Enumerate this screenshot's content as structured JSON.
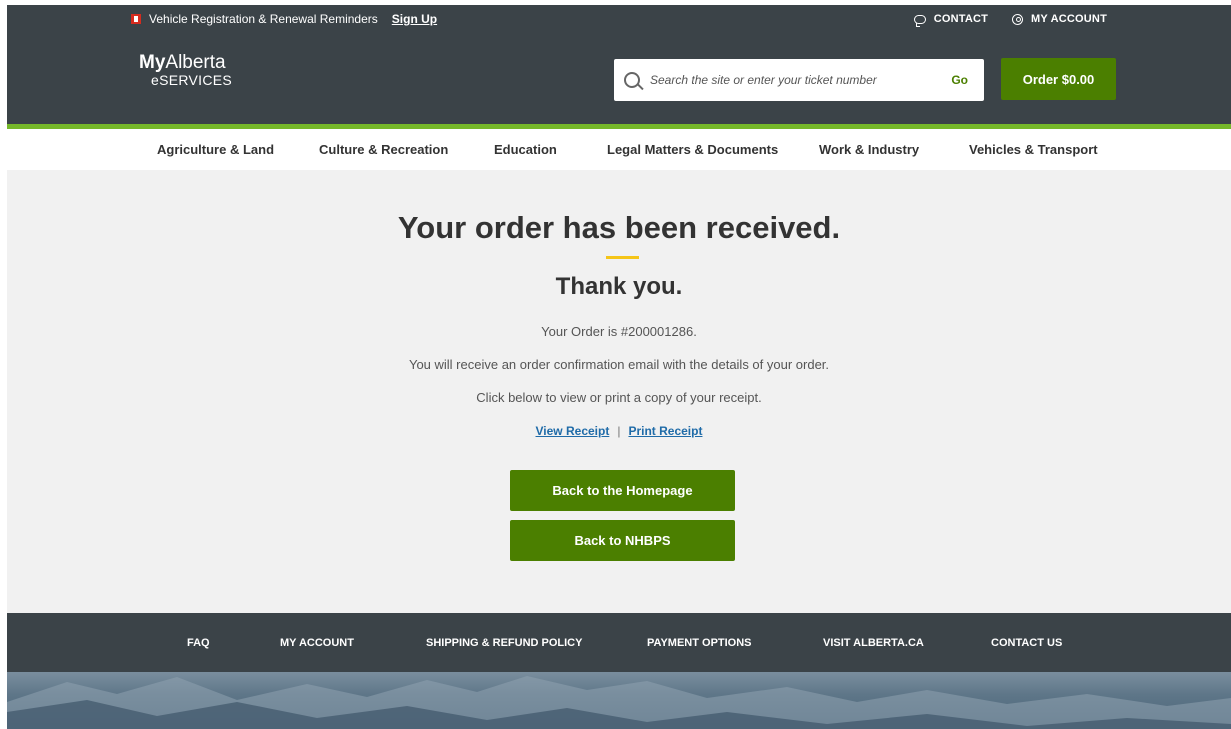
{
  "utility": {
    "reminder_text": "Vehicle Registration & Renewal Reminders",
    "signup_label": "Sign Up",
    "contact_label": "CONTACT",
    "account_label": "MY ACCOUNT"
  },
  "header": {
    "logo_my": "My",
    "logo_alberta": "Alberta",
    "logo_eservices": "eSERVICES",
    "search_placeholder": "Search the site or enter your ticket number",
    "search_go": "Go",
    "order_label": "Order $0.00"
  },
  "nav": {
    "items": [
      "Agriculture & Land",
      "Culture & Recreation",
      "Education",
      "Legal Matters & Documents",
      "Work & Industry",
      "Vehicles & Transport"
    ]
  },
  "main": {
    "heading": "Your order has been received.",
    "subheading": "Thank you.",
    "order_text": "Your Order is #200001286.",
    "email_text": "You will receive an order confirmation email with the details of your order.",
    "click_text": "Click below to view or print a copy of your receipt.",
    "view_receipt": "View Receipt",
    "separator": "|",
    "print_receipt": "Print Receipt",
    "back_home": "Back to the Homepage",
    "back_nhbps": "Back to NHBPS"
  },
  "footer": {
    "items": [
      "FAQ",
      "MY ACCOUNT",
      "SHIPPING & REFUND POLICY",
      "PAYMENT OPTIONS",
      "VISIT ALBERTA.CA",
      "CONTACT US"
    ]
  },
  "colors": {
    "header_bg": "#3b4348",
    "brand_green": "#4b7f00",
    "accent_green": "#76b82a",
    "accent_yellow": "#f5c518",
    "link_blue": "#1f6ba8"
  }
}
